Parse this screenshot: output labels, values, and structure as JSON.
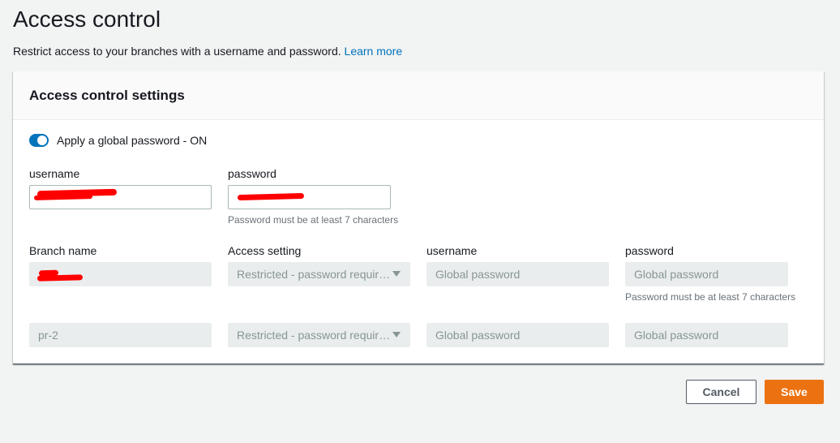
{
  "page": {
    "title": "Access control",
    "subtitle": "Restrict access to your branches with a username and password.",
    "learn_more": "Learn more"
  },
  "panel": {
    "title": "Access control settings",
    "toggle": {
      "label": "Apply a global password - ON",
      "on": true
    },
    "global": {
      "username_label": "username",
      "password_label": "password",
      "username_value": "",
      "password_value": "",
      "password_hint": "Password must be at least 7 characters"
    },
    "table": {
      "headers": {
        "branch": "Branch name",
        "access": "Access setting",
        "username": "username",
        "password": "password"
      },
      "rows": [
        {
          "branch": "",
          "access": "Restricted - password required",
          "username": "Global password",
          "password": "Global password",
          "password_hint": "Password must be at least 7 characters"
        },
        {
          "branch": "pr-2",
          "access": "Restricted - password required",
          "username": "Global password",
          "password": "Global password"
        }
      ]
    }
  },
  "actions": {
    "cancel": "Cancel",
    "save": "Save"
  },
  "colors": {
    "accent": "#0073bb",
    "primary_button": "#ec7211",
    "redaction": "#ff0000"
  }
}
